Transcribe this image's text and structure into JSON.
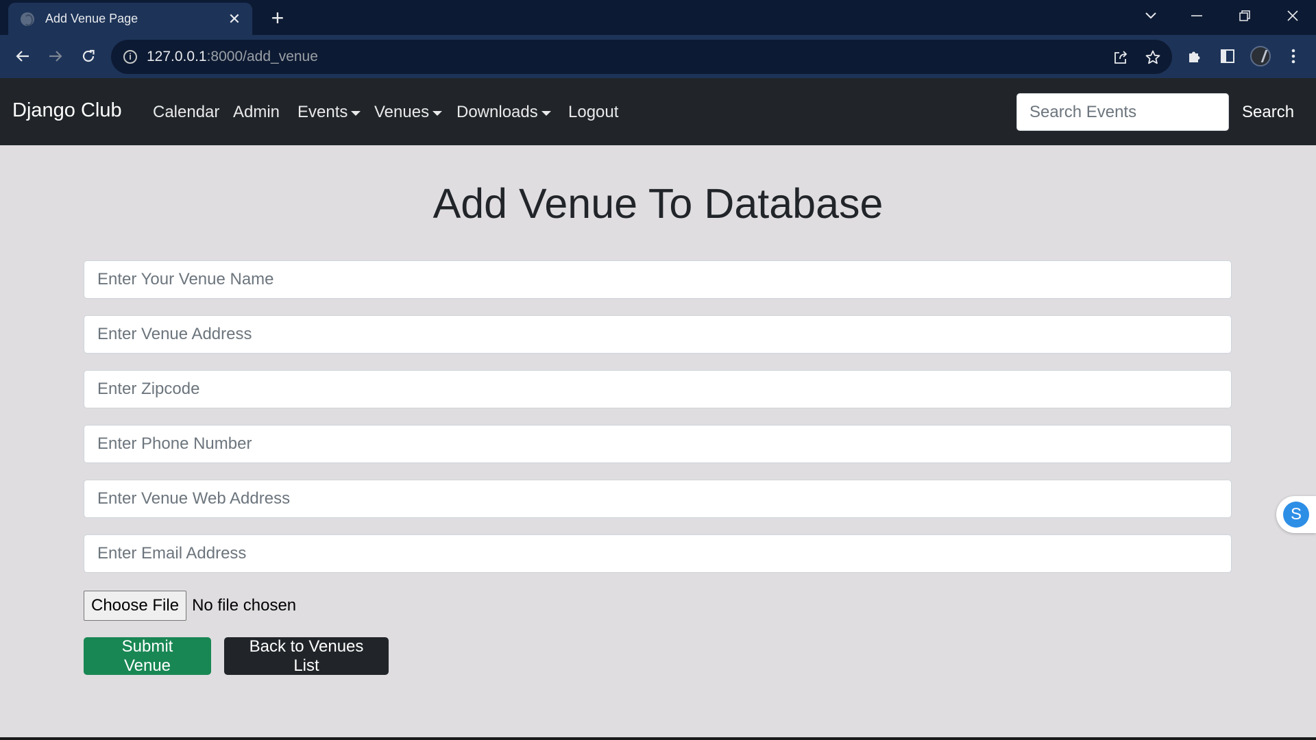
{
  "browser": {
    "tab_title": "Add Venue Page",
    "url_host": "127.0.0.1",
    "url_path": ":8000/add_venue"
  },
  "navbar": {
    "brand": "Django Club",
    "links": [
      {
        "label": "Calendar",
        "dropdown": false
      },
      {
        "label": "Admin",
        "dropdown": false
      },
      {
        "label": "Events",
        "dropdown": true
      },
      {
        "label": "Venues",
        "dropdown": true
      },
      {
        "label": "Downloads",
        "dropdown": true
      },
      {
        "label": "Logout",
        "dropdown": false
      }
    ],
    "search_placeholder": "Search Events",
    "search_button": "Search"
  },
  "form": {
    "heading": "Add Venue To Database",
    "fields": [
      {
        "placeholder": "Enter Your Venue Name",
        "value": ""
      },
      {
        "placeholder": "Enter Venue Address",
        "value": ""
      },
      {
        "placeholder": "Enter Zipcode",
        "value": ""
      },
      {
        "placeholder": "Enter Phone Number",
        "value": ""
      },
      {
        "placeholder": "Enter Venue Web Address",
        "value": ""
      },
      {
        "placeholder": "Enter Email Address",
        "value": ""
      }
    ],
    "file_button": "Choose File",
    "file_status": "No file chosen",
    "submit_label": "Submit Venue",
    "back_label": "Back to Venues List"
  },
  "floating_widget": {
    "letter": "S"
  },
  "colors": {
    "navbar_bg": "#212529",
    "page_bg": "#dfdde0",
    "submit_bg": "#198754",
    "back_bg": "#212529",
    "browser_frame": "#0d1a33",
    "browser_toolbar": "#1d3358"
  }
}
